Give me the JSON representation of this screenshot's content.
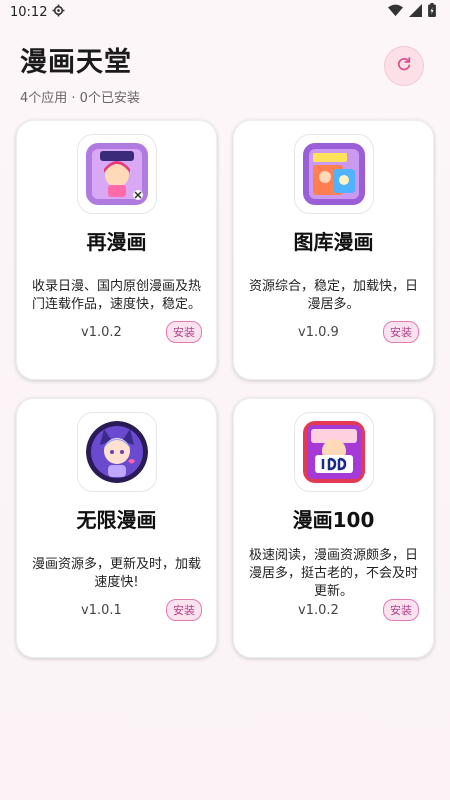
{
  "status": {
    "time": "10:12",
    "icons": [
      "settings-icon",
      "wifi-icon",
      "signal-icon",
      "battery-icon"
    ]
  },
  "header": {
    "title": "漫画天堂",
    "subtitle": "4个应用 · 0个已安装"
  },
  "colors": {
    "accent": "#e27bb5",
    "refresh_bg": "#fbe0e8",
    "install_text": "#b0448a"
  },
  "apps": [
    {
      "name": "再漫画",
      "desc": "收录日漫、国内原创漫画及热门连载作品，速度快，稳定。",
      "version": "v1.0.2",
      "action": "安装"
    },
    {
      "name": "图库漫画",
      "desc": "资源综合，稳定，加载快，日漫居多。",
      "version": "v1.0.9",
      "action": "安装"
    },
    {
      "name": "无限漫画",
      "desc": "漫画资源多，更新及时，加载速度快!",
      "version": "v1.0.1",
      "action": "安装"
    },
    {
      "name": "漫画100",
      "desc": "极速阅读，漫画资源颇多，日漫居多，挺古老的，不会及时更新。",
      "version": "v1.0.2",
      "action": "安装"
    }
  ]
}
